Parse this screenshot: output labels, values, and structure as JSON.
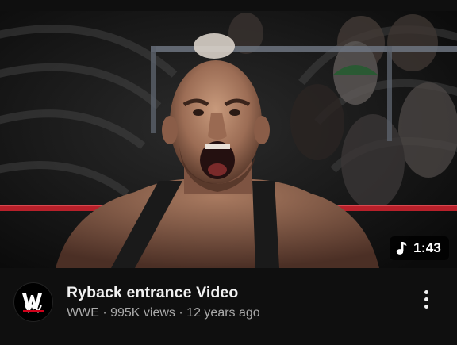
{
  "video": {
    "title": "Ryback entrance Video",
    "channel": "WWE",
    "separator": "·",
    "views": "995K views",
    "age": "12 years ago",
    "duration": "1:43",
    "duration_icon": "music-note-icon",
    "thumbnail_icon": "video-thumbnail",
    "channel_avatar_icon": "wwe-logo-icon",
    "menu_icon": "more-vertical-icon"
  },
  "colors": {
    "background": "#0f0f0f",
    "title": "#f1f1f1",
    "meta": "#aaaaaa",
    "ring_rope": "#b8202a"
  }
}
